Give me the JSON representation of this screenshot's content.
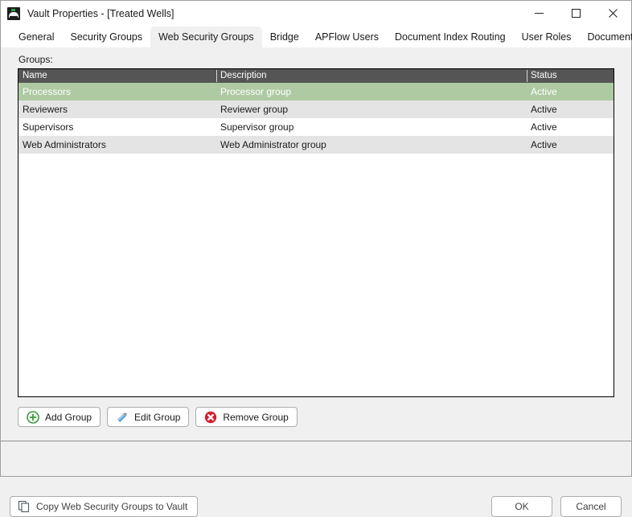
{
  "window": {
    "title": "Vault Properties - [Treated Wells]",
    "icon": "vault-app-icon",
    "controls": {
      "minimize": "minimize-icon",
      "maximize": "maximize-icon",
      "close": "close-icon"
    }
  },
  "tabs": [
    {
      "label": "General",
      "active": false
    },
    {
      "label": "Security Groups",
      "active": false
    },
    {
      "label": "Web Security Groups",
      "active": true
    },
    {
      "label": "Bridge",
      "active": false
    },
    {
      "label": "APFlow Users",
      "active": false
    },
    {
      "label": "Document Index Routing",
      "active": false
    },
    {
      "label": "User Roles",
      "active": false
    },
    {
      "label": "Document Publishing",
      "active": false
    }
  ],
  "main": {
    "groups_label": "Groups:",
    "columns": [
      "Name",
      "Description",
      "Status"
    ],
    "rows": [
      {
        "name": "Processors",
        "description": "Processor group",
        "status": "Active",
        "selected": true
      },
      {
        "name": "Reviewers",
        "description": "Reviewer group",
        "status": "Active",
        "selected": false
      },
      {
        "name": "Supervisors",
        "description": "Supervisor group",
        "status": "Active",
        "selected": false
      },
      {
        "name": "Web Administrators",
        "description": "Web Administrator group",
        "status": "Active",
        "selected": false
      }
    ]
  },
  "actions": {
    "add": {
      "label": "Add Group",
      "icon": "add-circle-icon"
    },
    "edit": {
      "label": "Edit Group",
      "icon": "pencil-icon"
    },
    "remove": {
      "label": "Remove Group",
      "icon": "remove-circle-icon"
    }
  },
  "footer": {
    "copy": {
      "label": "Copy Web Security Groups to Vault",
      "icon": "copy-icon"
    },
    "ok": "OK",
    "cancel": "Cancel"
  },
  "colors": {
    "selection_green": "#aecaa2",
    "header_gray": "#555555",
    "alt_row": "#e4e4e4",
    "add_icon_green": "#3a9a3a",
    "edit_icon_blue": "#4a9fd4",
    "remove_icon_red": "#d32030",
    "window_bg": "#f0f0f0"
  }
}
